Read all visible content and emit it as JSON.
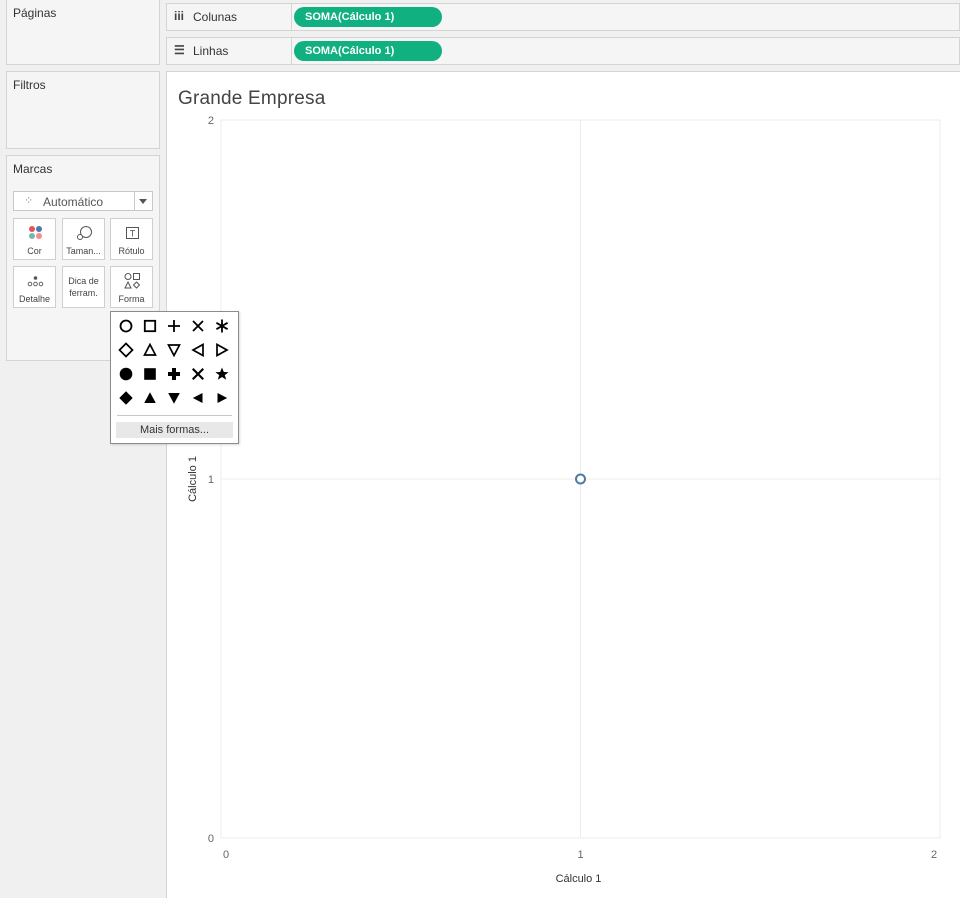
{
  "left_panel": {
    "pages_title": "Páginas",
    "filters_title": "Filtros",
    "marks": {
      "title": "Marcas",
      "mark_type": "Automático",
      "buttons": {
        "color": "Cor",
        "size": "Taman...",
        "label": "Rótulo",
        "detail": "Detalhe",
        "tooltip_line1": "Dica de",
        "tooltip_line2": "ferram.",
        "shape": "Forma"
      }
    }
  },
  "shelves": {
    "columns": {
      "label": "Colunas",
      "pill": "SOMA(Cálculo 1)"
    },
    "rows": {
      "label": "Linhas",
      "pill": "SOMA(Cálculo 1)"
    }
  },
  "view": {
    "title": "Grande Empresa"
  },
  "shape_popup": {
    "shapes": [
      "circle-outline",
      "square-outline",
      "plus-thin",
      "cross-thin",
      "asterisk",
      "diamond-outline",
      "triangle-up-outline",
      "triangle-down-outline",
      "triangle-left-outline",
      "triangle-right-outline",
      "circle-filled",
      "square-filled",
      "plus-filled",
      "cross-filled",
      "star-filled",
      "diamond-filled",
      "triangle-up-filled",
      "triangle-down-filled",
      "triangle-left-filled",
      "triangle-right-filled"
    ],
    "more_shapes": "Mais formas..."
  },
  "colors": {
    "pill": "#10b080",
    "mark_stroke": "#4e79a7"
  },
  "chart_data": {
    "type": "scatter",
    "title": "Grande Empresa",
    "xlabel": "Cálculo 1",
    "ylabel": "Cálculo 1",
    "xlim": [
      0,
      2
    ],
    "ylim": [
      0,
      2
    ],
    "x_ticks": [
      "0",
      "1",
      "2"
    ],
    "y_ticks": [
      "0",
      "1",
      "2"
    ],
    "grid": true,
    "points": [
      {
        "x": 1,
        "y": 1
      }
    ]
  }
}
